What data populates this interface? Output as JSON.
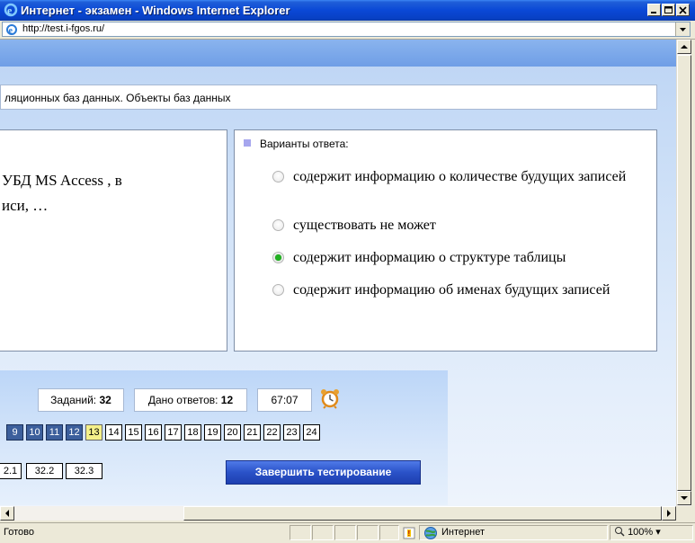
{
  "window": {
    "title": "Интернет - экзамен - Windows Internet Explorer",
    "url": "http://test.i-fgos.ru/"
  },
  "page": {
    "topic": "ляционных баз данных. Объекты баз данных",
    "question_lines": [
      "УБД MS Access , в",
      "иси, …"
    ],
    "answers_header": "Варианты ответа:",
    "answers": [
      {
        "text": "содержит информацию о количестве будущих записей",
        "checked": false
      },
      {
        "text": "существовать не может",
        "checked": false
      },
      {
        "text": "содержит информацию о структуре таблицы",
        "checked": true
      },
      {
        "text": "содержит информацию об именах будущих записей",
        "checked": false
      }
    ]
  },
  "controls": {
    "tasks_label": "Заданий:",
    "tasks_value": "32",
    "answered_label": "Дано ответов:",
    "answered_value": "12",
    "timer": "67:07",
    "question_numbers": [
      {
        "n": "9",
        "state": "done"
      },
      {
        "n": "10",
        "state": "done"
      },
      {
        "n": "11",
        "state": "done"
      },
      {
        "n": "12",
        "state": "done"
      },
      {
        "n": "13",
        "state": "current"
      },
      {
        "n": "14",
        "state": "open"
      },
      {
        "n": "15",
        "state": "open"
      },
      {
        "n": "16",
        "state": "open"
      },
      {
        "n": "17",
        "state": "open"
      },
      {
        "n": "18",
        "state": "open"
      },
      {
        "n": "19",
        "state": "open"
      },
      {
        "n": "20",
        "state": "open"
      },
      {
        "n": "21",
        "state": "open"
      },
      {
        "n": "22",
        "state": "open"
      },
      {
        "n": "23",
        "state": "open"
      },
      {
        "n": "24",
        "state": "open"
      }
    ],
    "sub_questions": [
      "2.1",
      "32.2",
      "32.3"
    ],
    "finish_label": "Завершить тестирование"
  },
  "statusbar": {
    "ready": "Готово",
    "zone": "Интернет",
    "zoom": "100%"
  },
  "colors": {
    "done": "#3c5f9c",
    "current": "#f4f08a",
    "checked_radio": "#22b022",
    "finish_button": "#2a52c8"
  }
}
